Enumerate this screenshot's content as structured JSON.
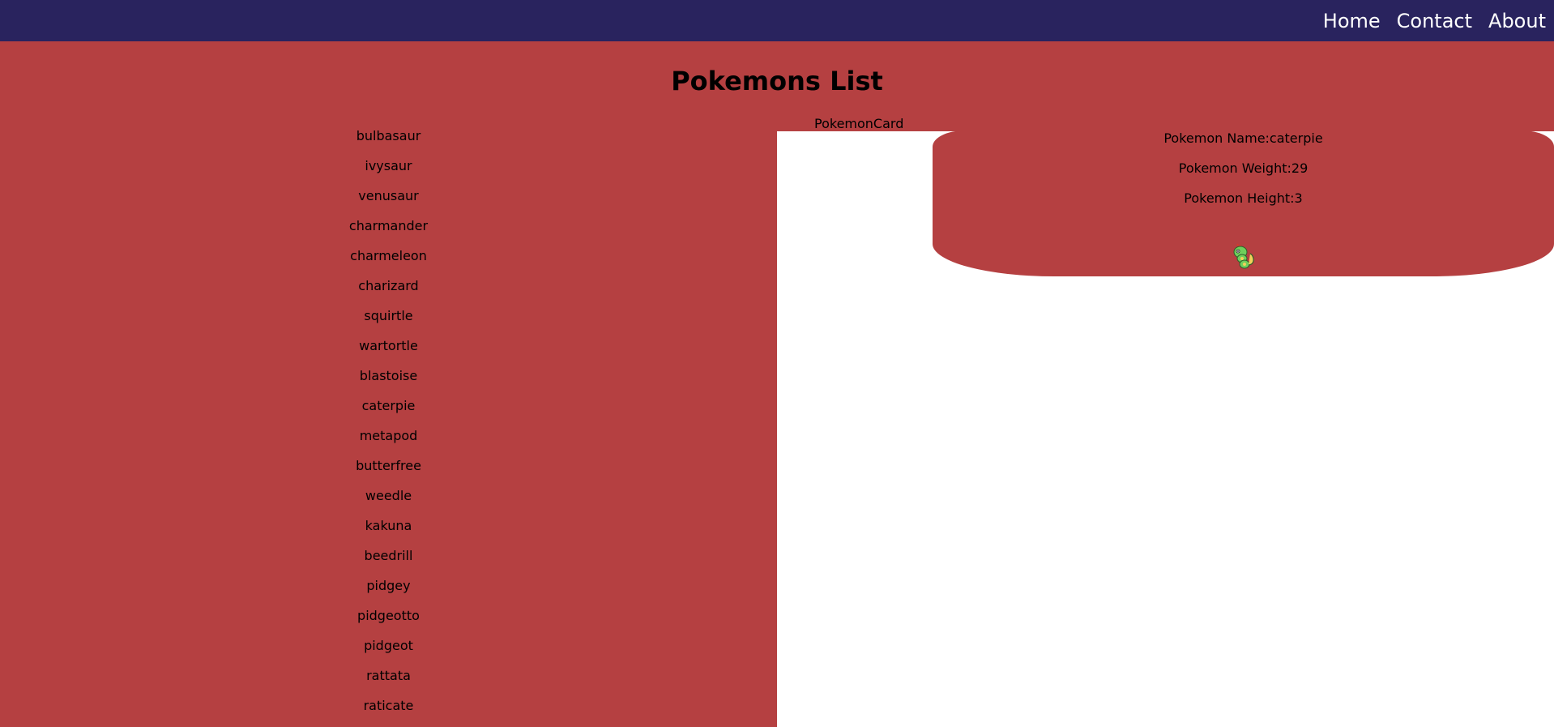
{
  "nav": {
    "links": [
      "Home",
      "Contact",
      "About"
    ]
  },
  "page": {
    "title": "Pokemons List"
  },
  "pokemon_list": [
    "bulbasaur",
    "ivysaur",
    "venusaur",
    "charmander",
    "charmeleon",
    "charizard",
    "squirtle",
    "wartortle",
    "blastoise",
    "caterpie",
    "metapod",
    "butterfree",
    "weedle",
    "kakuna",
    "beedrill",
    "pidgey",
    "pidgeotto",
    "pidgeot",
    "rattata",
    "raticate"
  ],
  "card": {
    "label": "PokemonCard",
    "name_line": "Pokemon Name:caterpie",
    "weight_line": "Pokemon Weight:29",
    "height_line": "Pokemon Height:3",
    "sprite": "caterpie-sprite-icon"
  },
  "colors": {
    "navbar": "#29235e",
    "panel": "#b54041",
    "background": "#ffffff"
  }
}
